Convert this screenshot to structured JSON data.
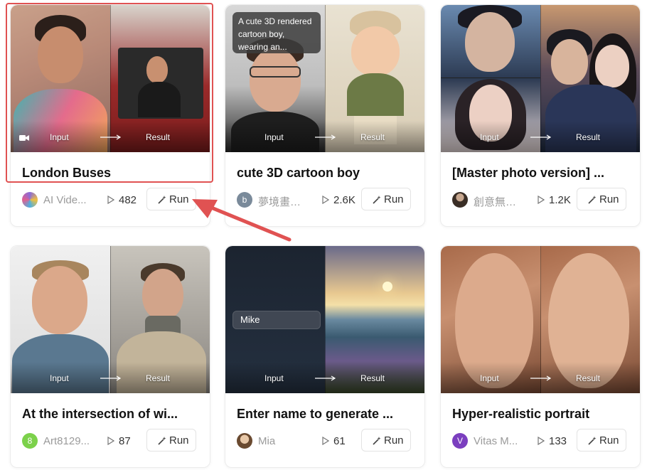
{
  "io": {
    "input_label": "Input",
    "result_label": "Result"
  },
  "run_label": "Run",
  "cards": [
    {
      "title": "London Buses",
      "author": "AI Vide...",
      "plays": "482",
      "avatar_letter": "",
      "avatar_color": "#8a6cd8"
    },
    {
      "title": "cute 3D cartoon boy",
      "author": "夢境畫境...",
      "plays": "2.6K",
      "avatar_letter": "b",
      "avatar_color": "#7a8a9a",
      "prompt": "A cute 3D rendered cartoon boy, wearing an..."
    },
    {
      "title": "[Master photo version] ...",
      "author": "創意無限...",
      "plays": "1.2K",
      "avatar_letter": "",
      "avatar_color": "#5a4a3a"
    },
    {
      "title": "At the intersection of wi...",
      "author": "Art8129...",
      "plays": "87",
      "avatar_letter": "8",
      "avatar_color": "#7cd14b"
    },
    {
      "title": "Enter name to generate ...",
      "author": "Mia",
      "plays": "61",
      "avatar_letter": "",
      "avatar_color": "#a88a6a",
      "name_value": "Mike"
    },
    {
      "title": "Hyper-realistic portrait",
      "author": "Vitas M...",
      "plays": "133",
      "avatar_letter": "V",
      "avatar_color": "#7b3fbf"
    }
  ],
  "colors": {
    "highlight": "#e05252",
    "arrow": "#e05252"
  }
}
